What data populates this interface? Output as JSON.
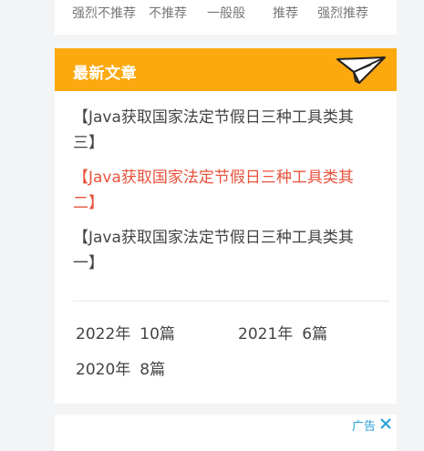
{
  "rating": {
    "labels": [
      "强烈不推荐",
      "不推荐",
      "一般般",
      "推荐",
      "强烈推荐"
    ]
  },
  "latest": {
    "title": "最新文章",
    "icon": "paper-plane-icon",
    "articles": [
      {
        "title": "【Java获取国家法定节假日三种工具类其三】",
        "highlighted": false
      },
      {
        "title": "【Java获取国家法定节假日三种工具类其二】",
        "highlighted": true
      },
      {
        "title": "【Java获取国家法定节假日三种工具类其一】",
        "highlighted": false
      }
    ],
    "archive": [
      {
        "year": "2022年",
        "count": "10篇"
      },
      {
        "year": "2021年",
        "count": "6篇"
      },
      {
        "year": "2020年",
        "count": "8篇"
      }
    ]
  },
  "ad": {
    "label": "广告",
    "close_icon": "close-icon"
  },
  "colors": {
    "header_bg": "#fca90f",
    "highlight_text": "#e8523c",
    "ad_blue": "#2aa0d8",
    "page_bg": "#f3f4f6"
  }
}
